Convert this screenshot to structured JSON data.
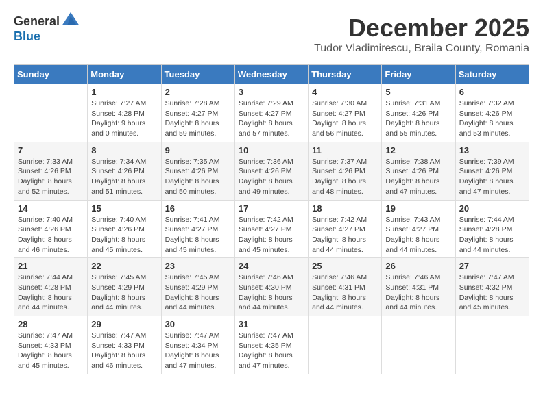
{
  "logo": {
    "general": "General",
    "blue": "Blue"
  },
  "title": "December 2025",
  "location": "Tudor Vladimirescu, Braila County, Romania",
  "days_of_week": [
    "Sunday",
    "Monday",
    "Tuesday",
    "Wednesday",
    "Thursday",
    "Friday",
    "Saturday"
  ],
  "weeks": [
    [
      {
        "day": "",
        "info": ""
      },
      {
        "day": "1",
        "info": "Sunrise: 7:27 AM\nSunset: 4:28 PM\nDaylight: 9 hours\nand 0 minutes."
      },
      {
        "day": "2",
        "info": "Sunrise: 7:28 AM\nSunset: 4:27 PM\nDaylight: 8 hours\nand 59 minutes."
      },
      {
        "day": "3",
        "info": "Sunrise: 7:29 AM\nSunset: 4:27 PM\nDaylight: 8 hours\nand 57 minutes."
      },
      {
        "day": "4",
        "info": "Sunrise: 7:30 AM\nSunset: 4:27 PM\nDaylight: 8 hours\nand 56 minutes."
      },
      {
        "day": "5",
        "info": "Sunrise: 7:31 AM\nSunset: 4:26 PM\nDaylight: 8 hours\nand 55 minutes."
      },
      {
        "day": "6",
        "info": "Sunrise: 7:32 AM\nSunset: 4:26 PM\nDaylight: 8 hours\nand 53 minutes."
      }
    ],
    [
      {
        "day": "7",
        "info": "Sunrise: 7:33 AM\nSunset: 4:26 PM\nDaylight: 8 hours\nand 52 minutes."
      },
      {
        "day": "8",
        "info": "Sunrise: 7:34 AM\nSunset: 4:26 PM\nDaylight: 8 hours\nand 51 minutes."
      },
      {
        "day": "9",
        "info": "Sunrise: 7:35 AM\nSunset: 4:26 PM\nDaylight: 8 hours\nand 50 minutes."
      },
      {
        "day": "10",
        "info": "Sunrise: 7:36 AM\nSunset: 4:26 PM\nDaylight: 8 hours\nand 49 minutes."
      },
      {
        "day": "11",
        "info": "Sunrise: 7:37 AM\nSunset: 4:26 PM\nDaylight: 8 hours\nand 48 minutes."
      },
      {
        "day": "12",
        "info": "Sunrise: 7:38 AM\nSunset: 4:26 PM\nDaylight: 8 hours\nand 47 minutes."
      },
      {
        "day": "13",
        "info": "Sunrise: 7:39 AM\nSunset: 4:26 PM\nDaylight: 8 hours\nand 47 minutes."
      }
    ],
    [
      {
        "day": "14",
        "info": "Sunrise: 7:40 AM\nSunset: 4:26 PM\nDaylight: 8 hours\nand 46 minutes."
      },
      {
        "day": "15",
        "info": "Sunrise: 7:40 AM\nSunset: 4:26 PM\nDaylight: 8 hours\nand 45 minutes."
      },
      {
        "day": "16",
        "info": "Sunrise: 7:41 AM\nSunset: 4:27 PM\nDaylight: 8 hours\nand 45 minutes."
      },
      {
        "day": "17",
        "info": "Sunrise: 7:42 AM\nSunset: 4:27 PM\nDaylight: 8 hours\nand 45 minutes."
      },
      {
        "day": "18",
        "info": "Sunrise: 7:42 AM\nSunset: 4:27 PM\nDaylight: 8 hours\nand 44 minutes."
      },
      {
        "day": "19",
        "info": "Sunrise: 7:43 AM\nSunset: 4:27 PM\nDaylight: 8 hours\nand 44 minutes."
      },
      {
        "day": "20",
        "info": "Sunrise: 7:44 AM\nSunset: 4:28 PM\nDaylight: 8 hours\nand 44 minutes."
      }
    ],
    [
      {
        "day": "21",
        "info": "Sunrise: 7:44 AM\nSunset: 4:28 PM\nDaylight: 8 hours\nand 44 minutes."
      },
      {
        "day": "22",
        "info": "Sunrise: 7:45 AM\nSunset: 4:29 PM\nDaylight: 8 hours\nand 44 minutes."
      },
      {
        "day": "23",
        "info": "Sunrise: 7:45 AM\nSunset: 4:29 PM\nDaylight: 8 hours\nand 44 minutes."
      },
      {
        "day": "24",
        "info": "Sunrise: 7:46 AM\nSunset: 4:30 PM\nDaylight: 8 hours\nand 44 minutes."
      },
      {
        "day": "25",
        "info": "Sunrise: 7:46 AM\nSunset: 4:31 PM\nDaylight: 8 hours\nand 44 minutes."
      },
      {
        "day": "26",
        "info": "Sunrise: 7:46 AM\nSunset: 4:31 PM\nDaylight: 8 hours\nand 44 minutes."
      },
      {
        "day": "27",
        "info": "Sunrise: 7:47 AM\nSunset: 4:32 PM\nDaylight: 8 hours\nand 45 minutes."
      }
    ],
    [
      {
        "day": "28",
        "info": "Sunrise: 7:47 AM\nSunset: 4:33 PM\nDaylight: 8 hours\nand 45 minutes."
      },
      {
        "day": "29",
        "info": "Sunrise: 7:47 AM\nSunset: 4:33 PM\nDaylight: 8 hours\nand 46 minutes."
      },
      {
        "day": "30",
        "info": "Sunrise: 7:47 AM\nSunset: 4:34 PM\nDaylight: 8 hours\nand 47 minutes."
      },
      {
        "day": "31",
        "info": "Sunrise: 7:47 AM\nSunset: 4:35 PM\nDaylight: 8 hours\nand 47 minutes."
      },
      {
        "day": "",
        "info": ""
      },
      {
        "day": "",
        "info": ""
      },
      {
        "day": "",
        "info": ""
      }
    ]
  ]
}
